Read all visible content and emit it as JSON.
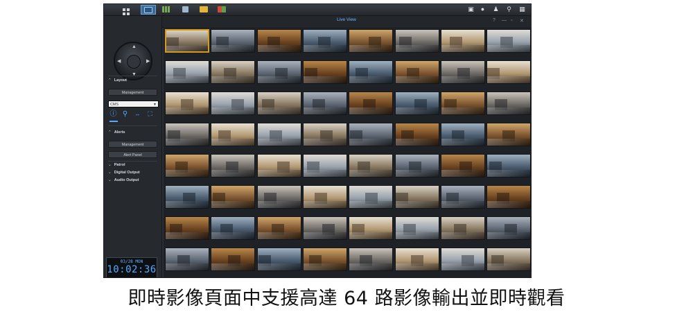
{
  "app": {
    "window_title": "Live View",
    "taskbar_apps": [
      {
        "name": "main-menu-icon",
        "active": false,
        "color": "#cfd4d9"
      },
      {
        "name": "live-view-icon",
        "active": true,
        "color": "#6fb4ff"
      },
      {
        "name": "timeline-icon",
        "active": false,
        "color": "#78a85a"
      },
      {
        "name": "camera-icon",
        "active": false,
        "color": "#9fb8d0"
      },
      {
        "name": "folder-icon",
        "active": false,
        "color": "#e5b53a"
      },
      {
        "name": "log-icon",
        "active": false,
        "color": "#d24a3a"
      }
    ],
    "tray_icons": [
      "lock-icon",
      "chat-icon",
      "user-icon",
      "search-icon",
      "widgets-icon"
    ],
    "window_controls": [
      "?",
      "—",
      "▫",
      "✕"
    ]
  },
  "panel": {
    "layout": {
      "header": "Layout",
      "management_button": "Management",
      "dropdown_value": "CMS",
      "icons": [
        "info-icon",
        "location-pin-icon",
        "fit-icon",
        "fullscreen-icon"
      ]
    },
    "alerts": {
      "header": "Alerts",
      "management_button": "Management",
      "alert_panel_button": "Alert Panel"
    },
    "collapsed_sections": [
      "Patrol",
      "Digital Output",
      "Audio Output"
    ],
    "clock": {
      "date": "03/28 MON",
      "time": "10:02:36"
    }
  },
  "grid": {
    "rows": 8,
    "columns": 8,
    "selected_cell": 0
  },
  "caption": "即時影像頁面中支援高達 64 路影像輸出並即時觀看",
  "accent_colors": {
    "highlight": "#6fb4ff",
    "selected_border": "#d49a1e"
  }
}
